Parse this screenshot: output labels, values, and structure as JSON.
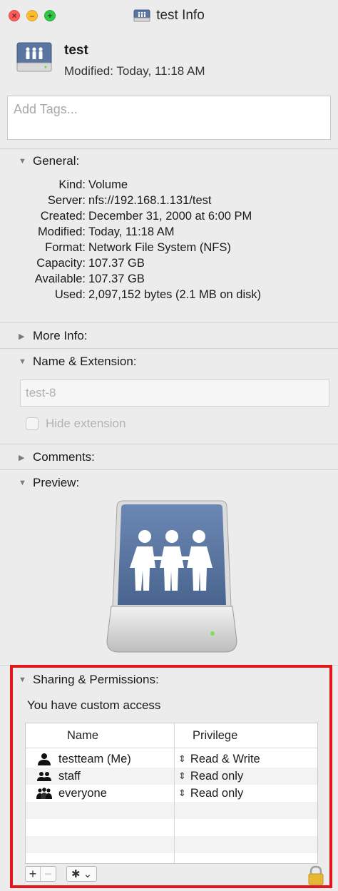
{
  "window": {
    "title": "test Info"
  },
  "header": {
    "name": "test",
    "modified": "Modified: Today, 11:18 AM"
  },
  "tags": {
    "placeholder": "Add Tags..."
  },
  "sections": {
    "general": "General:",
    "more_info": "More Info:",
    "name_extension": "Name & Extension:",
    "comments": "Comments:",
    "preview": "Preview:",
    "sharing": "Sharing & Permissions:"
  },
  "general": [
    {
      "key": "Kind:",
      "value": "Volume"
    },
    {
      "key": "Server:",
      "value": "nfs://192.168.1.131/test"
    },
    {
      "key": "Created:",
      "value": "December 31, 2000 at 6:00 PM"
    },
    {
      "key": "Modified:",
      "value": "Today, 11:18 AM"
    },
    {
      "key": "Format:",
      "value": "Network File System (NFS)"
    },
    {
      "key": "Capacity:",
      "value": "107.37 GB"
    },
    {
      "key": "Available:",
      "value": "107.37 GB"
    },
    {
      "key": "Used:",
      "value": "2,097,152 bytes (2.1 MB on disk)"
    }
  ],
  "name_extension": {
    "value": "test-8",
    "hide_extension_label": "Hide extension"
  },
  "sharing": {
    "access_text": "You have custom access",
    "columns": {
      "name": "Name",
      "privilege": "Privilege"
    },
    "rows": [
      {
        "name": "testteam (Me)",
        "privilege": "Read & Write",
        "icon": "single-user-icon"
      },
      {
        "name": "staff",
        "privilege": "Read only",
        "icon": "group-icon"
      },
      {
        "name": "everyone",
        "privilege": "Read only",
        "icon": "everyone-icon"
      }
    ]
  },
  "colors": {
    "highlight": "#e3161b",
    "drive_blue": "#5a76a0"
  }
}
